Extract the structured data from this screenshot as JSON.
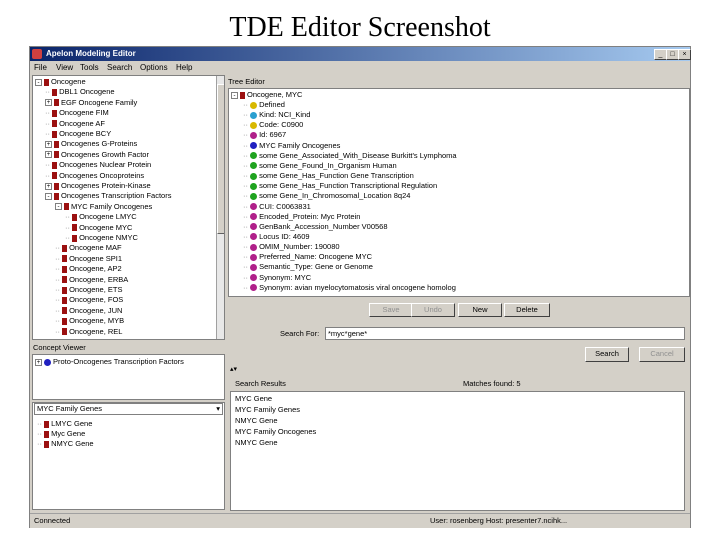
{
  "slide": {
    "title": "TDE Editor Screenshot"
  },
  "window": {
    "title": "Apelon Modeling Editor",
    "buttons": [
      "_",
      "□",
      "×"
    ]
  },
  "menu": [
    "File",
    "View",
    "Tools",
    "Search",
    "Options",
    "Help"
  ],
  "left_tree": {
    "items": [
      {
        "label": "Oncogene",
        "indent": 0,
        "icon": "folder",
        "exp": "-"
      },
      {
        "label": "DBL1 Oncogene",
        "indent": 2,
        "icon": "folder",
        "exp": ""
      },
      {
        "label": "EGF Oncogene Family",
        "indent": 2,
        "icon": "folder",
        "exp": "+"
      },
      {
        "label": "Oncogene FIM",
        "indent": 2,
        "icon": "folder",
        "exp": ""
      },
      {
        "label": "Oncogene AF",
        "indent": 2,
        "icon": "folder",
        "exp": ""
      },
      {
        "label": "Oncogene BCY",
        "indent": 2,
        "icon": "folder",
        "exp": ""
      },
      {
        "label": "Oncogenes G-Proteins",
        "indent": 2,
        "icon": "folder",
        "exp": "+"
      },
      {
        "label": "Oncogenes Growth Factor",
        "indent": 2,
        "icon": "folder",
        "exp": "+"
      },
      {
        "label": "Oncogenes Nuclear Protein",
        "indent": 2,
        "icon": "folder",
        "exp": ""
      },
      {
        "label": "Oncogenes Oncoproteins",
        "indent": 2,
        "icon": "folder",
        "exp": ""
      },
      {
        "label": "Oncogenes Protein-Kinase",
        "indent": 2,
        "icon": "folder",
        "exp": "+"
      },
      {
        "label": "Oncogenes Transcription Factors",
        "indent": 2,
        "icon": "folder",
        "exp": "-"
      },
      {
        "label": "MYC Family Oncogenes",
        "indent": 4,
        "icon": "folder",
        "exp": "-"
      },
      {
        "label": "Oncogene LMYC",
        "indent": 6,
        "icon": "folder",
        "exp": ""
      },
      {
        "label": "Oncogene MYC",
        "indent": 6,
        "icon": "folder",
        "exp": ""
      },
      {
        "label": "Oncogene NMYC",
        "indent": 6,
        "icon": "folder",
        "exp": ""
      },
      {
        "label": "Oncogene MAF",
        "indent": 4,
        "icon": "folder",
        "exp": ""
      },
      {
        "label": "Oncogene SPI1",
        "indent": 4,
        "icon": "folder",
        "exp": ""
      },
      {
        "label": "Oncogene, AP2",
        "indent": 4,
        "icon": "folder",
        "exp": ""
      },
      {
        "label": "Oncogene, ERBA",
        "indent": 4,
        "icon": "folder",
        "exp": ""
      },
      {
        "label": "Oncogene, ETS",
        "indent": 4,
        "icon": "folder",
        "exp": ""
      },
      {
        "label": "Oncogene, FOS",
        "indent": 4,
        "icon": "folder",
        "exp": ""
      },
      {
        "label": "Oncogene, JUN",
        "indent": 4,
        "icon": "folder",
        "exp": ""
      },
      {
        "label": "Oncogene, MYB",
        "indent": 4,
        "icon": "folder",
        "exp": ""
      },
      {
        "label": "Oncogene, REL",
        "indent": 4,
        "icon": "folder",
        "exp": ""
      }
    ]
  },
  "concept_viewer": {
    "title": "Concept Viewer",
    "item": "Proto-Oncogenes Transcription Factors"
  },
  "family_list": {
    "header": "MYC Family Genes",
    "items": [
      "LMYC Gene",
      "Myc Gene",
      "NMYC Gene"
    ]
  },
  "tree_editor": {
    "title": "Tree Editor",
    "root": "Oncogene, MYC",
    "items": [
      {
        "label": "Defined",
        "color": "#d8b800"
      },
      {
        "label": "Kind: NCI_Kind",
        "color": "#2a9fd0"
      },
      {
        "label": "Code: C0900",
        "color": "#d8b800"
      },
      {
        "label": "Id: 6967",
        "color": "#b0208a"
      },
      {
        "label": "MYC Family Oncogenes",
        "color": "#2020c0"
      },
      {
        "label": "some Gene_Associated_With_Disease Burkitt's Lymphoma",
        "color": "#1fa31f"
      },
      {
        "label": "some Gene_Found_In_Organism Human",
        "color": "#1fa31f"
      },
      {
        "label": "some Gene_Has_Function Gene Transcription",
        "color": "#1fa31f"
      },
      {
        "label": "some Gene_Has_Function Transcriptional Regulation",
        "color": "#1fa31f"
      },
      {
        "label": "some Gene_In_Chromosomal_Location 8q24",
        "color": "#1fa31f"
      },
      {
        "label": "CUI: C0063831",
        "color": "#b0208a"
      },
      {
        "label": "Encoded_Protein: Myc Protein",
        "color": "#b0208a"
      },
      {
        "label": "GenBank_Accession_Number V00568",
        "color": "#b0208a"
      },
      {
        "label": "Locus ID: 4609",
        "color": "#b0208a"
      },
      {
        "label": "OMIM_Number: 190080",
        "color": "#b0208a"
      },
      {
        "label": "Preferred_Name: Oncogene MYC",
        "color": "#b0208a"
      },
      {
        "label": "Semantic_Type: Gene or Genome",
        "color": "#b0208a"
      },
      {
        "label": "Synonym: MYC",
        "color": "#b0208a"
      },
      {
        "label": "Synonym: avian myelocytomatosis viral oncogene homolog",
        "color": "#b0208a"
      }
    ],
    "buttons": {
      "save": "Save",
      "undo": "Undo",
      "new": "New",
      "delete": "Delete"
    }
  },
  "search": {
    "label": "Search For:",
    "value": "*myc*gene*",
    "search_button": "Search",
    "cancel_button": "Cancel",
    "results_label": "Search Results",
    "matches_label": "Matches found: 5",
    "results": [
      "MYC Gene",
      "MYC Family Genes",
      "NMYC Gene",
      "MYC Family Oncogenes",
      "NMYC Gene"
    ]
  },
  "status": {
    "left": "Connected",
    "right": "User: rosenberg Host: presenter7.ncihk..."
  },
  "colors": {
    "folder": "#9b1010",
    "titlebar": "#0a246a"
  }
}
